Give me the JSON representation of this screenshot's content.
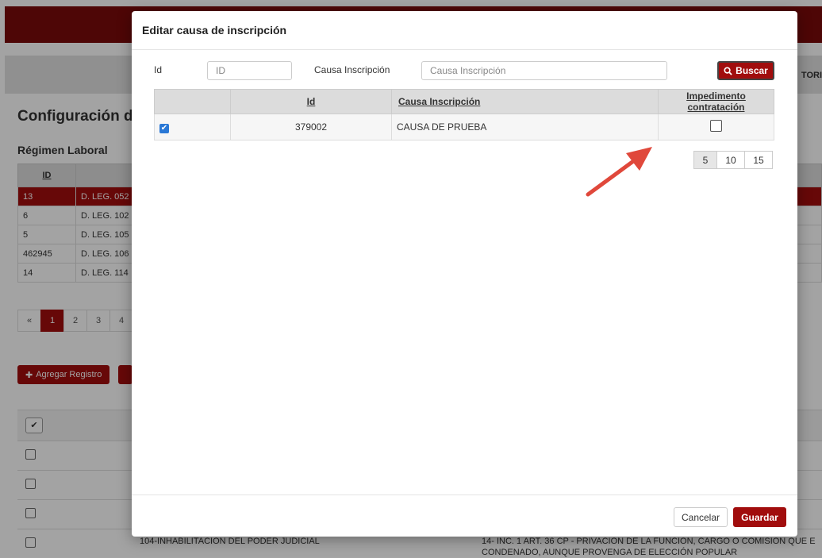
{
  "background": {
    "nav_tail": "TORI",
    "page_title": "Configuración d",
    "section_title": "Régimen Laboral",
    "table_header_id": "ID",
    "rows": [
      {
        "id": "13",
        "name": "D. LEG. 052"
      },
      {
        "id": "6",
        "name": "D. LEG. 102"
      },
      {
        "id": "5",
        "name": "D. LEG. 105"
      },
      {
        "id": "462945",
        "name": "D. LEG. 106"
      },
      {
        "id": "14",
        "name": "D. LEG. 114"
      }
    ],
    "pager": [
      "«",
      "1",
      "2",
      "3",
      "4"
    ],
    "add_button": "Agregar Registro",
    "row_text_left": "104-INHABILITACION DEL PODER JUDICIAL",
    "row_text_right_1": "14- INC. 1 ART. 36 CP - PRIVACION DE LA FUNCION, CARGO O COMISION QUE E",
    "row_text_right_2": "CONDENADO, AUNQUE PROVENGA DE ELECCIÓN POPULAR"
  },
  "modal": {
    "title": "Editar causa de inscripción",
    "filters": {
      "id_label": "Id",
      "id_placeholder": "ID",
      "causa_label": "Causa Inscripción",
      "causa_placeholder": "Causa Inscripción",
      "search_button": "Buscar"
    },
    "table": {
      "headers": {
        "id": "Id",
        "causa": "Causa Inscripción",
        "impedimento": "Impedimento contratación"
      },
      "rows": [
        {
          "selected": true,
          "id": "379002",
          "causa": "CAUSA DE PRUEBA",
          "impedimento": false
        }
      ]
    },
    "page_sizes": [
      "5",
      "10",
      "15"
    ],
    "active_page_size": "5",
    "footer": {
      "cancel": "Cancelar",
      "save": "Guardar"
    }
  },
  "colors": {
    "brand": "#a10d0d",
    "checkbox_blue": "#2a78d6",
    "arrow": "#e0483b"
  }
}
